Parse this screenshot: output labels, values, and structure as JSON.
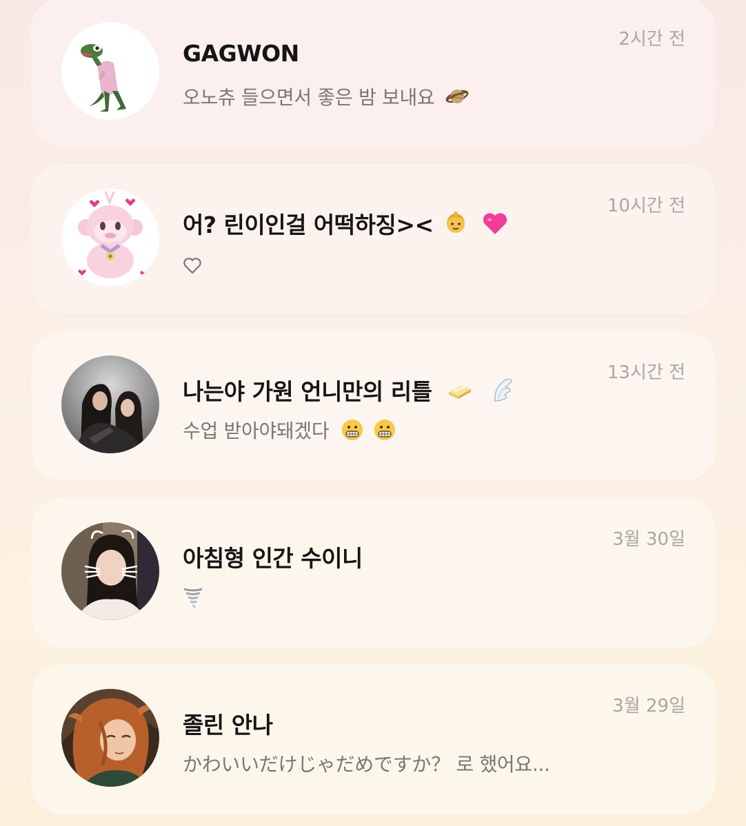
{
  "chats": [
    {
      "name": "GAGWON",
      "message": "오노츄 들으면서 좋은 밤 보내요",
      "message_emoji": "ringed-planet-icon",
      "time": "2시간 전"
    },
    {
      "name": "어? 린이인걸 어떡하징><",
      "name_emojis": [
        "girl-face-icon",
        "pink-heart-icon"
      ],
      "message": "",
      "message_emoji": "heart-outline-icon",
      "time": "10시간 전"
    },
    {
      "name": "나는야 가원 언니만의 리틀",
      "name_emojis": [
        "butter-icon",
        "wing-icon"
      ],
      "message": "수업 받아야돼겠다",
      "message_emojis": [
        "grimacing-face-icon",
        "grimacing-face-icon"
      ],
      "time": "13시간 전"
    },
    {
      "name": "아침형 인간 수이니",
      "message": "",
      "message_emoji": "tornado-icon",
      "time": "3월 30일"
    },
    {
      "name": "졸린 안나",
      "message": "かわいいだけじゃだめですか？ 로 했어요...",
      "time": "3월 29일"
    }
  ],
  "colors": {
    "name_text": "#151515",
    "message_text": "#777777",
    "time_text": "#a9a6a3",
    "card_bg": "#fdf4ef"
  }
}
